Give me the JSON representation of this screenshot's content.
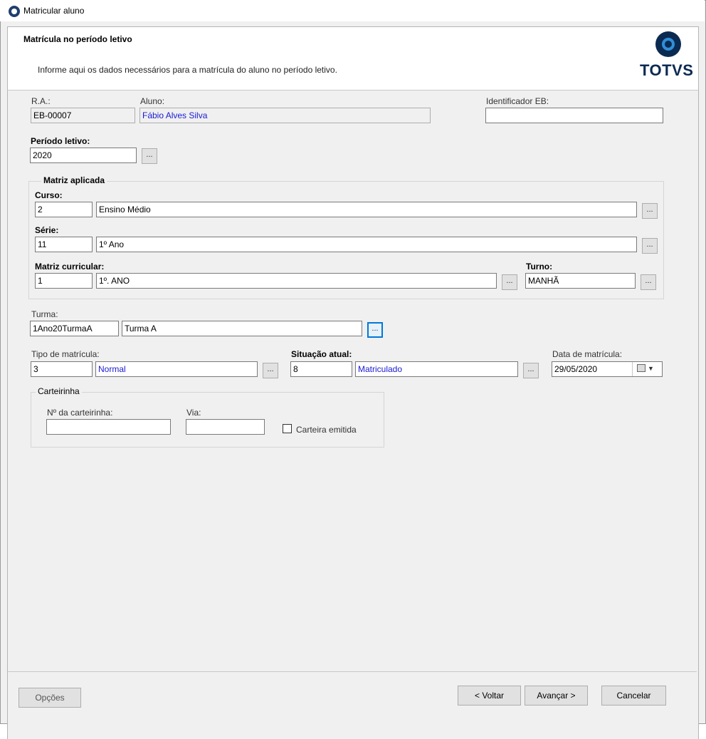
{
  "window": {
    "title": "Matricular aluno"
  },
  "header": {
    "title": "Matrícula no período letivo",
    "description": "Informe aqui os dados necessários para a matrícula do aluno no período letivo.",
    "logo_text": "TOTVS"
  },
  "student": {
    "ra_label": "R.A.:",
    "ra_value": "EB-00007",
    "aluno_label": "Aluno:",
    "aluno_value": "Fábio Alves Silva",
    "eb_label": "Identificador EB:",
    "eb_value": ""
  },
  "periodo": {
    "label": "Período letivo:",
    "value": "2020",
    "lookup": "..."
  },
  "matriz": {
    "group_title": "Matriz aplicada",
    "curso_label": "Curso:",
    "curso_code": "2",
    "curso_name": "Ensino Médio",
    "serie_label": "Série:",
    "serie_code": "11",
    "serie_name": "1º Ano",
    "matriz_label": "Matriz curricular:",
    "matriz_code": "1",
    "matriz_name": "1º. ANO",
    "turno_label": "Turno:",
    "turno_value": "MANHÃ",
    "lookup": "..."
  },
  "turma": {
    "label": "Turma:",
    "code": "1Ano20TurmaA",
    "name": "Turma A",
    "lookup": "..."
  },
  "tipo": {
    "label": "Tipo de matrícula:",
    "code": "3",
    "name": "Normal",
    "lookup": "..."
  },
  "situacao": {
    "label": "Situação atual:",
    "code": "8",
    "name": "Matriculado",
    "lookup": "..."
  },
  "data_matricula": {
    "label": "Data de matrícula:",
    "value": "29/05/2020"
  },
  "carteirinha": {
    "group_title": "Carteirinha",
    "numero_label": "Nº da carteirinha:",
    "numero_value": "",
    "via_label": "Via:",
    "via_value": "",
    "emitida_label": "Carteira emitida",
    "emitida_checked": false
  },
  "footer": {
    "options_label": "Opções",
    "back_label": "< Voltar",
    "next_label": "Avançar >",
    "cancel_label": "Cancelar"
  },
  "colors": {
    "link_blue": "#1a1ad4",
    "focus_blue": "#0078d7",
    "logo_navy": "#0b2a52",
    "logo_blue": "#2f8fd8"
  }
}
